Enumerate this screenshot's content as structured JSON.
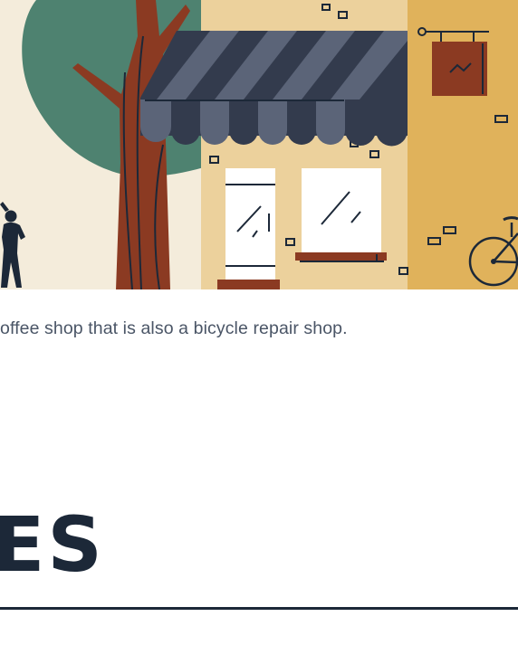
{
  "illustration": {
    "subject": "storefront-with-tree-awning-sign-bicycle",
    "colors": {
      "sky": "#f4ecdb",
      "tree_foliage": "#4e8270",
      "trunk": "#8b3a22",
      "shop_wall": "#ecd19c",
      "side_wall": "#e0b25b",
      "awning_dark": "#333b4d",
      "awning_light": "#5b6478",
      "window": "#ffffff",
      "sign": "#8b3a22",
      "line": "#1c2838"
    }
  },
  "caption": "offee shop that is also a bicycle repair shop.",
  "section_heading": "ES"
}
